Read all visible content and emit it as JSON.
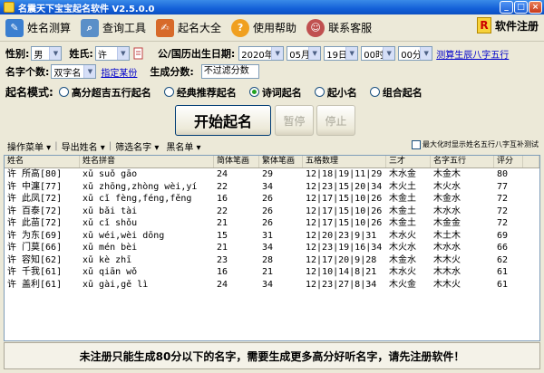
{
  "window": {
    "title": "名震天下宝宝起名软件 V2.5.0.0",
    "controls": [
      "_",
      "□",
      "×"
    ]
  },
  "toolbar": {
    "items": [
      {
        "label": "姓名测算",
        "icon": "book-icon",
        "color": "#3b7fd0"
      },
      {
        "label": "查询工具",
        "icon": "magnifier-icon",
        "color": "#5a8fc8"
      },
      {
        "label": "起名大全",
        "icon": "edit-icon",
        "color": "#d76a2a"
      },
      {
        "label": "使用帮助",
        "icon": "help-icon",
        "color": "#f0a020"
      },
      {
        "label": "联系客服",
        "icon": "person-icon",
        "color": "#c05050"
      }
    ],
    "register": {
      "label": "软件注册",
      "icon_text": "R"
    }
  },
  "form": {
    "gender_label": "性别:",
    "gender": "男",
    "surname_label": "姓氏:",
    "surname": "许",
    "birth_label": "公/国历出生日期:",
    "year": "2020年",
    "month": "05月",
    "day": "19日",
    "hour": "00时",
    "minute": "00分",
    "calc_link": "测算生辰八字五行",
    "name_count_label": "名字个数:",
    "name_count": "双字名",
    "assign_link": "指定某份",
    "score_label": "生成分数:",
    "score": "不过滤分数"
  },
  "modes": {
    "label": "起名模式:",
    "options": [
      "高分超吉五行起名",
      "经典推荐起名",
      "诗词起名",
      "起小名",
      "组合起名"
    ],
    "selected_index": 2
  },
  "buttons": {
    "start": "开始起名",
    "pause": "暂停",
    "stop": "停止"
  },
  "submenu": {
    "items": [
      "操作菜单",
      "导出姓名",
      "筛选名字",
      "黑名单"
    ],
    "checkbox_label": "最大化时显示姓名五行八字互补测试"
  },
  "table": {
    "columns": [
      "姓名",
      "姓名拼音",
      "简体笔画",
      "繁体笔画",
      "五格数理",
      "三才",
      "名字五行",
      "评分"
    ],
    "rows": [
      [
        "许 所高[80]",
        "xǔ suǒ gāo",
        "24",
        "29",
        "12|18|19|11|29",
        "木水金",
        "木金木",
        "80"
      ],
      [
        "许 中瀍[77]",
        "xǔ zhōng,zhòng wèi,yí",
        "22",
        "34",
        "12|23|15|20|34",
        "木火土",
        "木火水",
        "77"
      ],
      [
        "许 此凤[72]",
        "xǔ cǐ fèng,féng,fěng",
        "16",
        "26",
        "12|17|15|10|26",
        "木金土",
        "木金水",
        "72"
      ],
      [
        "许 百泰[72]",
        "xǔ bǎi tài",
        "22",
        "26",
        "12|17|15|10|26",
        "木金土",
        "木水水",
        "72"
      ],
      [
        "许 此苗[72]",
        "xǔ cǐ shǒu",
        "21",
        "26",
        "12|17|15|10|26",
        "木金土",
        "木金金",
        "72"
      ],
      [
        "许 为东[69]",
        "xǔ wéi,wèi dōng",
        "15",
        "31",
        "12|20|23|9|31",
        "木水火",
        "木土木",
        "69"
      ],
      [
        "许 门莫[66]",
        "xǔ mén bèi",
        "21",
        "34",
        "12|23|19|16|34",
        "木火水",
        "木水水",
        "66"
      ],
      [
        "许 容知[62]",
        "xǔ kè zhī",
        "23",
        "28",
        "12|17|20|9|28",
        "木金水",
        "木木火",
        "62"
      ],
      [
        "许 千我[61]",
        "xǔ qiān wǒ",
        "16",
        "21",
        "12|10|14|8|21",
        "木水火",
        "木木水",
        "61"
      ],
      [
        "许 盖利[61]",
        "xǔ gài,gě lì",
        "24",
        "34",
        "12|23|27|8|34",
        "木火金",
        "木木火",
        "61"
      ]
    ]
  },
  "status": {
    "message": "未注册只能生成80分以下的名字，需要生成更多高分好听名字，请先注册软件！"
  }
}
